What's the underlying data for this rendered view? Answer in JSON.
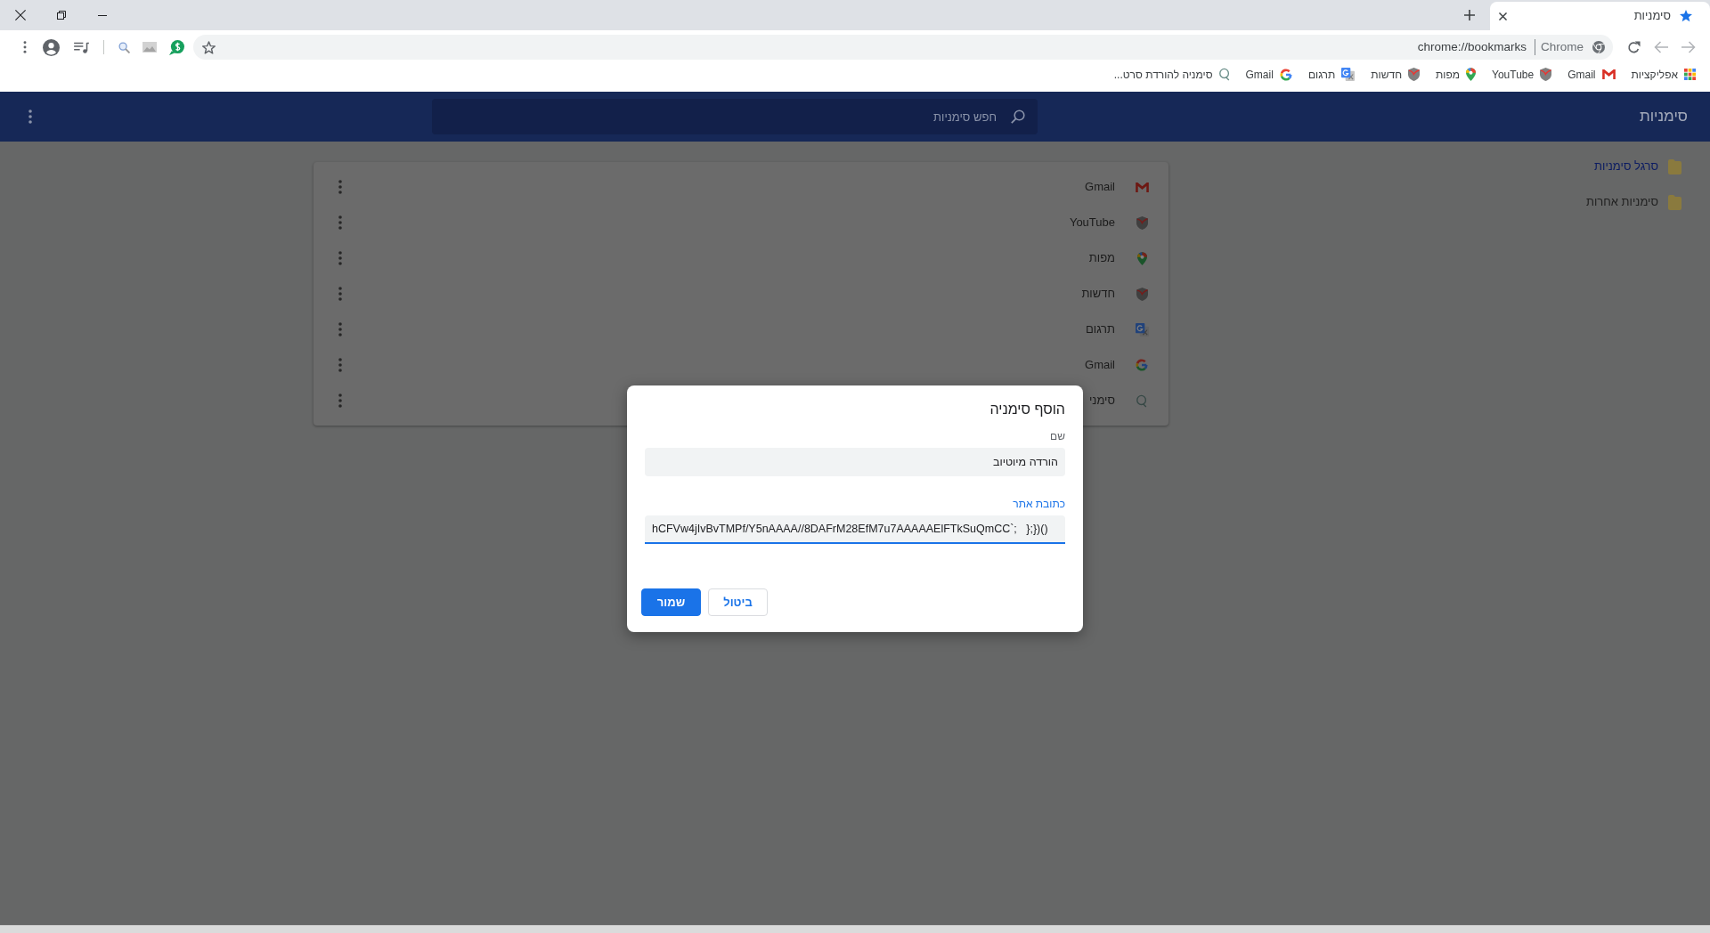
{
  "tabs": [
    {
      "title": "סימניות",
      "selected": true
    }
  ],
  "address_bar": {
    "site_label": "Chrome",
    "url": "chrome://bookmarks"
  },
  "bookmarks_bar": [
    {
      "kind": "apps",
      "label": "אפליקציות"
    },
    {
      "kind": "mail",
      "label": "Gmail"
    },
    {
      "kind": "shield",
      "label": "YouTube"
    },
    {
      "kind": "pin",
      "label": "מפות"
    },
    {
      "kind": "shield",
      "label": "חדשות"
    },
    {
      "kind": "translate",
      "label": "תרגום"
    },
    {
      "kind": "g",
      "label": "Gmail"
    },
    {
      "kind": "ring",
      "label": "סימניה להורדת סרט..."
    }
  ],
  "page": {
    "title": "סימניות",
    "search": {
      "placeholder": "חפש סימניות"
    },
    "sidebar": {
      "items": [
        {
          "label": "סרגל סימניות",
          "selected": true
        },
        {
          "label": "סימניות אחרות",
          "selected": false
        }
      ]
    },
    "bookmarks": [
      {
        "kind": "mail",
        "title": "Gmail"
      },
      {
        "kind": "shield",
        "title": "YouTube"
      },
      {
        "kind": "pin",
        "title": "מפות"
      },
      {
        "kind": "shield",
        "title": "חדשות"
      },
      {
        "kind": "translate",
        "title": "תרגום"
      },
      {
        "kind": "g",
        "title": "Gmail"
      },
      {
        "kind": "ring",
        "title": "סימני"
      }
    ]
  },
  "dialog": {
    "title": "הוסף סימניה",
    "fields": [
      {
        "label": "שם",
        "value": "הורדה מיוטיוב",
        "focused": false
      },
      {
        "label": "כתובת אתר",
        "value": "hCFVw4jIvBvTMPf/Y5nAAAA//8DAFrM28EfM7u7AAAAAElFTkSuQmCC`;   };})()",
        "focused": true
      }
    ],
    "buttons": [
      {
        "label": "ביטול",
        "kind": "secondary"
      },
      {
        "label": "שמור",
        "kind": "primary"
      }
    ]
  }
}
